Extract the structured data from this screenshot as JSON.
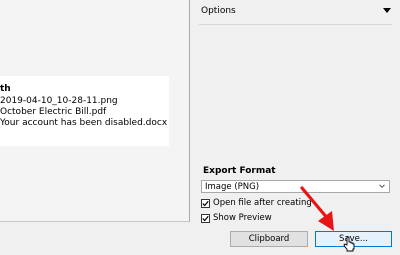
{
  "preview": {
    "heading": "th",
    "lines": [
      "2019-04-10_10-28-11.png",
      "October Electric Bill.pdf",
      "Your account has been disabled.docx"
    ]
  },
  "options": {
    "header": "Options",
    "export_format_label": "Export Format",
    "format_selected": "Image (PNG)",
    "open_after_creating_label": "Open file after creating",
    "open_after_creating_checked": true,
    "show_preview_label": "Show Preview",
    "show_preview_checked": true,
    "clipboard_button": "Clipboard",
    "save_button": "Save..."
  },
  "annotation": {
    "arrow_color": "#e81515"
  },
  "icons": [
    "caret-down-icon",
    "chevron-down-icon",
    "check-icon",
    "arrow-annotation-icon",
    "mouse-cursor-icon"
  ]
}
